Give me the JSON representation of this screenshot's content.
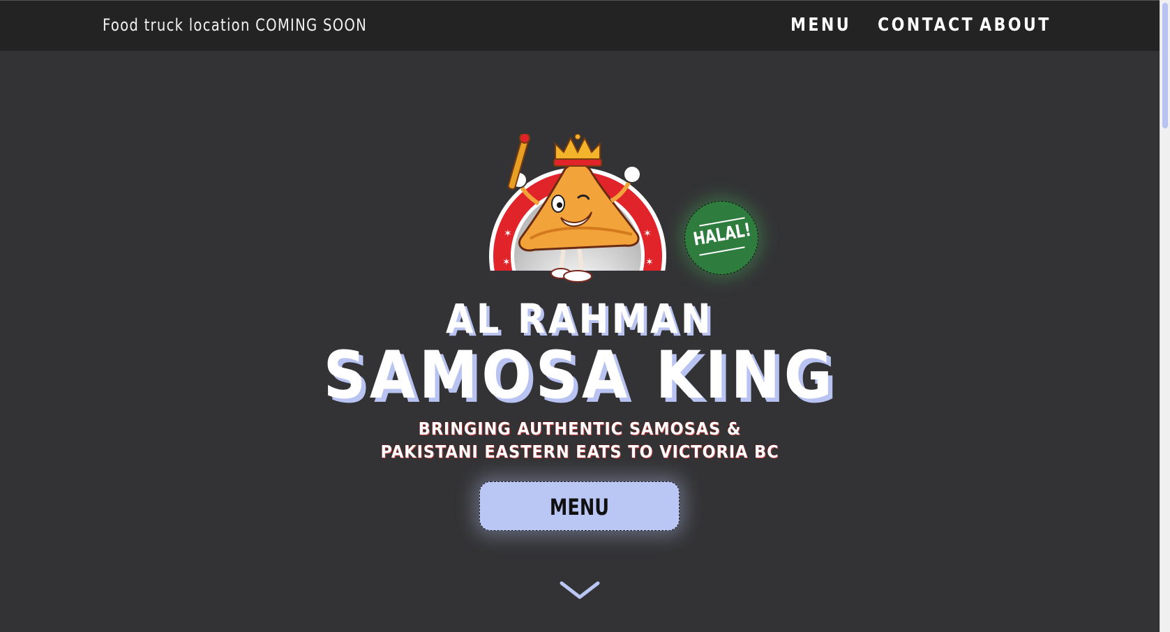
{
  "topbar": {
    "location_text": "Food truck location COMING SOON"
  },
  "nav": {
    "items": [
      {
        "label": "MENU"
      },
      {
        "label": "CONTACT"
      },
      {
        "label": "ABOUT"
      }
    ]
  },
  "hero": {
    "badge_text": "HALAL!",
    "title_small": "AL RAHMAN",
    "title_big": "SAMOSA KING",
    "tagline_line1": "BRINGING AUTHENTIC SAMOSAS &",
    "tagline_line2": "PAKISTANI EASTERN EATS TO VICTORIA BC",
    "menu_button_label": "MENU",
    "scroll_icon": "chevron-down-icon"
  },
  "colors": {
    "background": "#333335",
    "topbar": "#232323",
    "accent": "#bac6f3",
    "halal_green": "#2f7d3e",
    "logo_red": "#e0242a"
  }
}
